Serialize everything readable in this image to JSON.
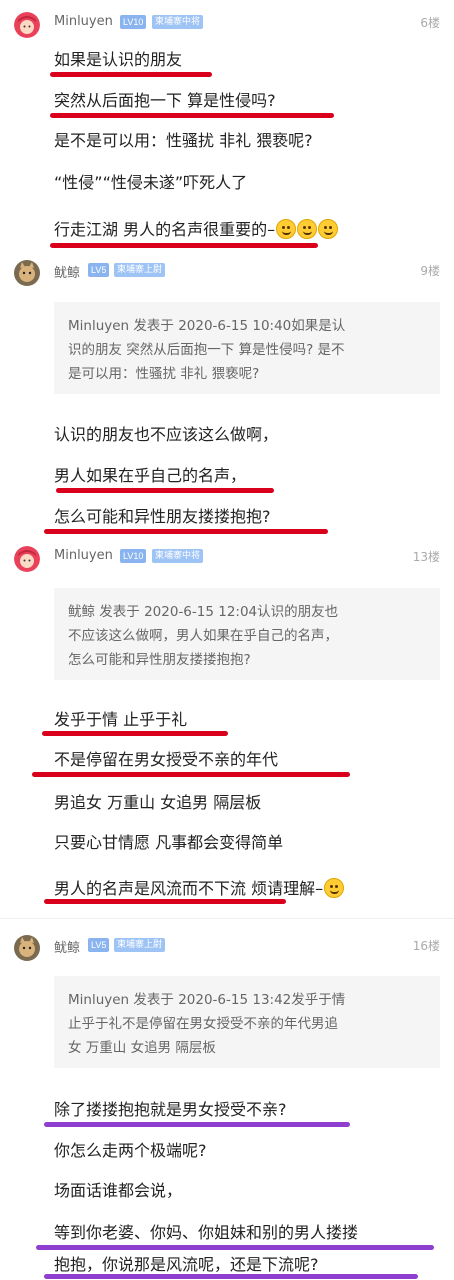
{
  "posts": [
    {
      "user": "Minluyen",
      "level": "LV10",
      "title": "柬埔寨中将",
      "floor": "6楼",
      "avatar": "masha-avatar",
      "lines": [
        "如果是认识的朋友",
        "突然从后面抱一下  算是性侵吗?",
        "是不是可以用：性骚扰  非礼  猥亵呢?",
        "“性侵”“性侵未遂”吓死人了",
        "行走江湖  男人的名声很重要的–"
      ],
      "emoji": [
        "smirk-emoji",
        "grin-emoji",
        "laugh-cry-emoji"
      ]
    },
    {
      "user": "鱿鲸",
      "level": "LV5",
      "title": "柬埔寨上尉",
      "floor": "9楼",
      "avatar": "cat-avatar",
      "quote": [
        "Minluyen 发表于 2020-6-15 10:40如果是认",
        "识的朋友 突然从后面抱一下 算是性侵吗? 是不",
        "是可以用：性骚扰 非礼 猥亵呢?"
      ],
      "lines": [
        "认识的朋友也不应该这么做啊，",
        "男人如果在乎自己的名声，",
        "怎么可能和异性朋友搂搂抱抱?"
      ]
    },
    {
      "user": "Minluyen",
      "level": "LV10",
      "title": "柬埔寨中将",
      "floor": "13楼",
      "avatar": "masha-avatar",
      "quote": [
        "鱿鲸 发表于 2020-6-15 12:04认识的朋友也",
        "不应该这么做啊，男人如果在乎自己的名声，",
        "怎么可能和异性朋友搂搂抱抱?"
      ],
      "lines": [
        "发乎于情  止乎于礼",
        "不是停留在男女授受不亲的年代",
        "男追女  万重山  女追男  隔层板",
        "只要心甘情愿  凡事都会变得简单",
        "男人的名声是风流而不下流  烦请理解–"
      ],
      "emoji": [
        "blush-emoji"
      ]
    },
    {
      "user": "鱿鲸",
      "level": "LV5",
      "title": "柬埔寨上尉",
      "floor": "16楼",
      "avatar": "cat-avatar",
      "quote": [
        "Minluyen 发表于 2020-6-15 13:42发乎于情",
        "止乎于礼不是停留在男女授受不亲的年代男追",
        "女 万重山 女追男 隔层板"
      ],
      "lines": [
        "除了搂搂抱抱就是男女授受不亲?",
        "你怎么走两个极端呢?",
        "场面话谁都会说，",
        "等到你老婆、你妈、你姐妹和别的男人搂搂",
        "抱抱，你说那是风流呢，还是下流呢?"
      ]
    }
  ],
  "colors": {
    "underline_red": "#d9001b",
    "underline_purple": "#8e3fcf",
    "badge": "#8ab4f0"
  }
}
